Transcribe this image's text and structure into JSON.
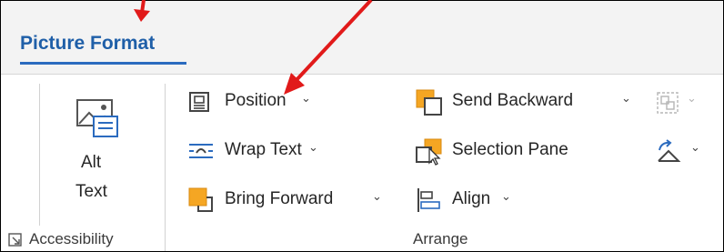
{
  "tab": {
    "label": "Picture Format"
  },
  "accessibility": {
    "alt_text_line1": "Alt",
    "alt_text_line2": "Text",
    "group_label": "Accessibility"
  },
  "arrange": {
    "position_label": "Position",
    "wrap_text_label": "Wrap Text",
    "bring_forward_label": "Bring Forward",
    "send_backward_label": "Send Backward",
    "selection_pane_label": "Selection Pane",
    "align_label": "Align",
    "group_label": "Arrange",
    "chevron": "⌄"
  },
  "colors": {
    "accent_blue": "#2b6bbf",
    "annotation_red": "#e11a1a",
    "orange": "#f5a623"
  }
}
